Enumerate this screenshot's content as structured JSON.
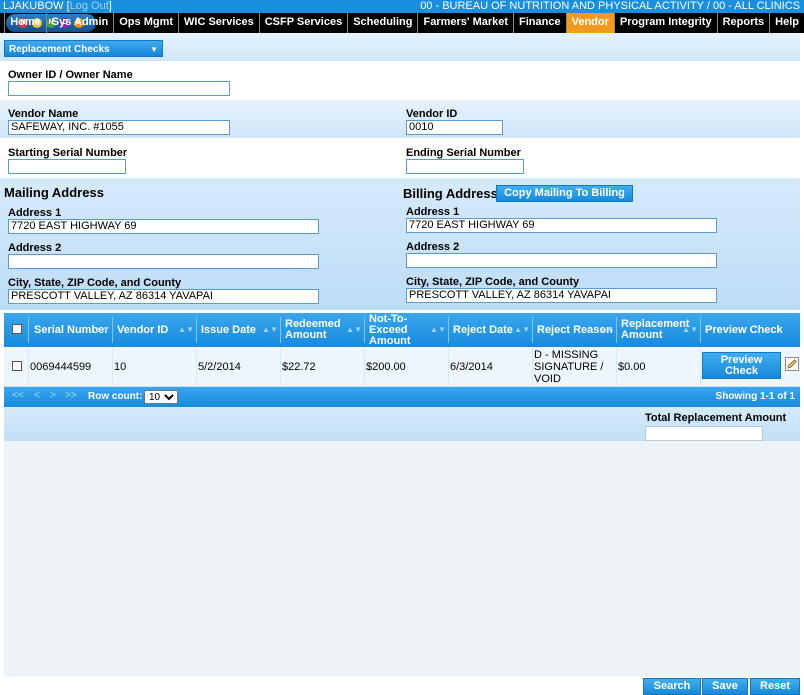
{
  "topbar": {
    "user": "LJAKUBOW",
    "user_link_open": "[",
    "user_link": "Log Out",
    "user_link_close": "]",
    "org": "00 - BUREAU OF NUTRITION AND PHYSICAL ACTIVITY / 00 - ALL CLINICS"
  },
  "logo": {
    "letters": [
      "H",
      "A",
      "N",
      "D",
      "S"
    ]
  },
  "nav": {
    "items": [
      "Home",
      "Sys Admin",
      "Ops Mgmt",
      "WIC Services",
      "CSFP Services",
      "Scheduling",
      "Farmers' Market",
      "Finance",
      "Vendor",
      "Program Integrity",
      "Reports",
      "Help"
    ],
    "active": "Vendor"
  },
  "page_selector": {
    "value": "Replacement Checks"
  },
  "form": {
    "owner_label": "Owner ID / Owner Name",
    "owner_value": "",
    "vendor_name_label": "Vendor Name",
    "vendor_name_value": "SAFEWAY, INC. #1055",
    "vendor_id_label": "Vendor ID",
    "vendor_id_value": "0010",
    "start_serial_label": "Starting Serial Number",
    "start_serial_value": "",
    "end_serial_label": "Ending Serial Number",
    "end_serial_value": ""
  },
  "mailing": {
    "title": "Mailing Address",
    "address1_label": "Address 1",
    "address1_value": "7720 EAST HIGHWAY 69",
    "address2_label": "Address 2",
    "address2_value": "",
    "city_label": "City, State, ZIP Code, and County",
    "city_value": "PRESCOTT VALLEY, AZ 86314 YAVAPAI"
  },
  "billing": {
    "title": "Billing Address",
    "copy_button": "Copy Mailing To Billing",
    "address1_label": "Address 1",
    "address1_value": "7720 EAST HIGHWAY 69",
    "address2_label": "Address 2",
    "address2_value": "",
    "city_label": "City, State, ZIP Code, and County",
    "city_value": "PRESCOTT VALLEY, AZ 86314 YAVAPAI"
  },
  "grid": {
    "columns": [
      "Serial Number",
      "Vendor ID",
      "Issue Date",
      "Redeemed Amount",
      "Not-To-Exceed Amount",
      "Reject Date",
      "Reject Reason",
      "Replacement Amount",
      "Preview Check"
    ],
    "rows": [
      {
        "serial": "0069444599",
        "vendor_id": "10",
        "issue_date": "5/2/2014",
        "redeemed": "$22.72",
        "not_to_exceed": "$200.00",
        "reject_date": "6/3/2014",
        "reject_reason": "D - MISSING SIGNATURE / VOID",
        "replacement": "$0.00",
        "preview_button": "Preview Check"
      }
    ]
  },
  "pager": {
    "first": "<<",
    "prev": "<",
    "next": ">",
    "last": ">>",
    "row_count_label": "Row count:",
    "row_count_value": "10",
    "showing": "Showing 1-1 of 1"
  },
  "totals": {
    "label": "Total Replacement Amount",
    "value": ""
  },
  "actions": {
    "search": "Search",
    "save": "Save",
    "reset": "Reset"
  }
}
